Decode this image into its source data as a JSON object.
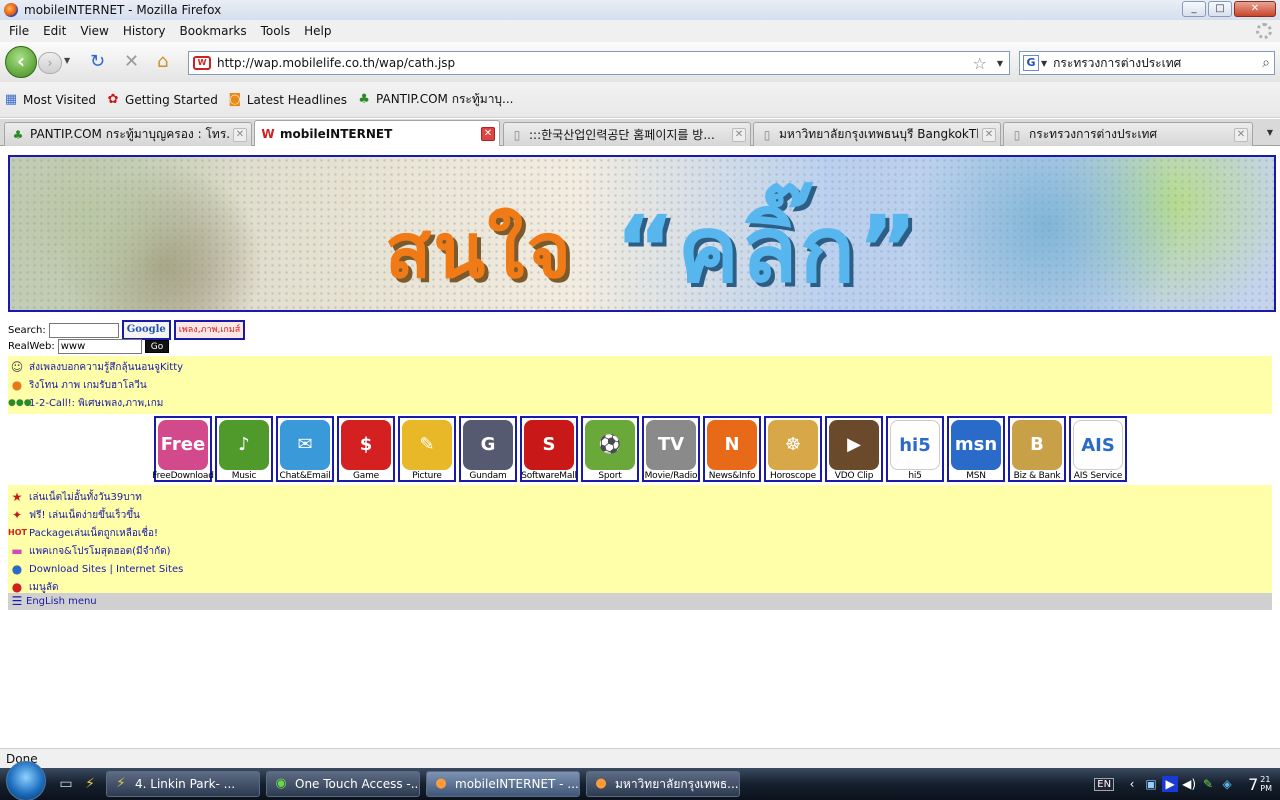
{
  "window": {
    "title": "mobileINTERNET - Mozilla Firefox"
  },
  "menu": [
    "File",
    "Edit",
    "View",
    "History",
    "Bookmarks",
    "Tools",
    "Help"
  ],
  "nav": {
    "url": "http://wap.mobilelife.co.th/wap/cath.jsp",
    "search_value": "กระทรวงการต่างประเทศ"
  },
  "bookmarks": [
    "Most Visited",
    "Getting Started",
    "Latest Headlines",
    "PANTIP.COM กระทู้มาบุ..."
  ],
  "tabs": [
    {
      "label": "PANTIP.COM กระทู้มาบุญครอง : โทร...",
      "active": false
    },
    {
      "label": "mobileINTERNET",
      "active": true
    },
    {
      "label": ":::한국산업인력공단 홈페이지를 방...",
      "active": false
    },
    {
      "label": "มหาวิทยาลัยกรุงเทพธนบุรี BangkokTh...",
      "active": false
    },
    {
      "label": "กระทรวงการต่างประเทศ",
      "active": false
    }
  ],
  "banner": {
    "word1": "สนใจ",
    "word2": "“คลิ๊ก”"
  },
  "form": {
    "search_label": "Search:",
    "google_label": "Google",
    "thai_button": "เพลง,ภาพ,เกมส์",
    "realweb_label": "RealWeb:",
    "realweb_value": "www",
    "go_label": "Go"
  },
  "top_links": [
    "ส่งเพลงบอกความรู้สึกลุ้นนอนจูKitty",
    "ริงโทน ภาพ เกมรับฮาโลวีน",
    "1-2-Call!: พิเศษเพลง,ภาพ,เกม"
  ],
  "apps": [
    {
      "label": "FreeDownload",
      "art": "Free",
      "color": "#d24a8c"
    },
    {
      "label": "Music",
      "art": "♪",
      "color": "#4f9a2a"
    },
    {
      "label": "Chat&Email",
      "art": "✉",
      "color": "#3a9ad9"
    },
    {
      "label": "Game",
      "art": "$",
      "color": "#d42020"
    },
    {
      "label": "Picture",
      "art": "✎",
      "color": "#e8b828"
    },
    {
      "label": "Gundam",
      "art": "G",
      "color": "#555a70"
    },
    {
      "label": "SoftwareMall",
      "art": "S",
      "color": "#c81818"
    },
    {
      "label": "Sport",
      "art": "⚽",
      "color": "#6aa83a"
    },
    {
      "label": "Movie/Radio",
      "art": "TV",
      "color": "#8a8a8a"
    },
    {
      "label": "News&Info",
      "art": "N",
      "color": "#e86a18"
    },
    {
      "label": "Horoscope",
      "art": "☸",
      "color": "#d8a848"
    },
    {
      "label": "VDO Clip",
      "art": "▶",
      "color": "#6a4a2a"
    },
    {
      "label": "hi5",
      "art": "hi5",
      "color": "#ffffff"
    },
    {
      "label": "MSN",
      "art": "msn",
      "color": "#2a6ac8"
    },
    {
      "label": "Biz & Bank",
      "art": "B",
      "color": "#c8a048"
    },
    {
      "label": "AIS Service",
      "art": "AIS",
      "color": "#ffffff"
    }
  ],
  "bottom_links": [
    "เล่นเน็ตไม่อั้นทั้งวัน39บาท",
    "ฟรี! เล่นเน็ตง่ายขึ้นเร็วขึ้น",
    "Packageเล่นเน็ตถูกเหลือเชื่อ!",
    "แพคเกจ&โปรโมสุดฮอต(มีจำกัด)",
    "Download Sites | Internet Sites",
    "เมนูลัด"
  ],
  "english_menu": "EngLish menu",
  "status": "Done",
  "taskbar": {
    "tasks": [
      {
        "label": "4. Linkin Park- ...",
        "active": false
      },
      {
        "label": "One Touch Access -...",
        "active": false
      },
      {
        "label": "mobileINTERNET - ...",
        "active": true
      },
      {
        "label": "มหาวิทยาลัยกรุงเทพธ...",
        "active": false
      }
    ],
    "lang": "EN",
    "clock": "7",
    "clock_min": "21",
    "ampm": "PM"
  }
}
